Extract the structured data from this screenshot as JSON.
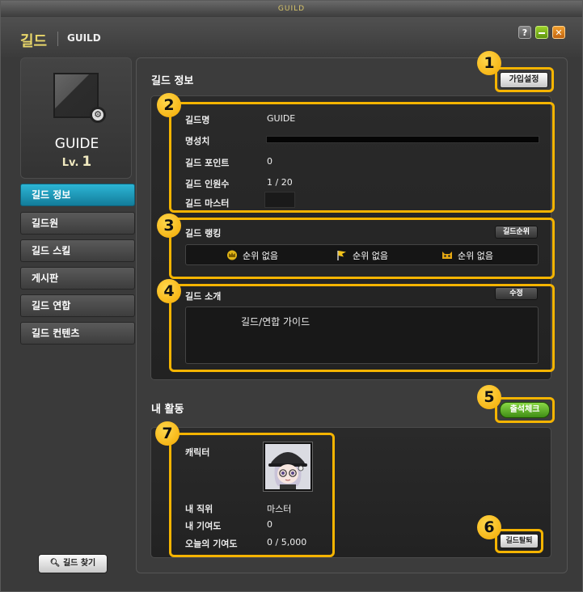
{
  "window": {
    "title": "GUILD"
  },
  "header": {
    "title": "길드",
    "subtitle": "GUILD",
    "help": "?",
    "minimize": "—",
    "close": "✕"
  },
  "sidebar": {
    "guild_name": "GUIDE",
    "level_label": "Lv.",
    "level": "1",
    "nav": [
      {
        "label": "길드 정보",
        "active": true
      },
      {
        "label": "길드원"
      },
      {
        "label": "길드 스킬"
      },
      {
        "label": "게시판"
      },
      {
        "label": "길드 연합"
      },
      {
        "label": "길드 컨텐츠"
      }
    ],
    "find_button": "길드 찾기"
  },
  "info": {
    "title": "길드 정보",
    "join_settings_button": "가입설정",
    "rows": [
      {
        "label": "길드명",
        "value": "GUIDE"
      },
      {
        "label": "명성치",
        "value": ""
      },
      {
        "label": "길드 포인트",
        "value": "0"
      },
      {
        "label": "길드 인원수",
        "value": "1 / 20"
      },
      {
        "label": "길드 마스터",
        "value": ""
      }
    ]
  },
  "ranking": {
    "title": "길드 랭킹",
    "button": "길드순위",
    "items": [
      {
        "icon": "crown-icon",
        "text": "순위 없음"
      },
      {
        "icon": "flag-icon",
        "text": "순위 없음"
      },
      {
        "icon": "mask-icon",
        "text": "순위 없음"
      }
    ]
  },
  "intro": {
    "title": "길드 소개",
    "edit_button": "수정",
    "text": "길드/연합 가이드"
  },
  "activity": {
    "title": "내 활동",
    "attendance_button": "출석체크",
    "character_label": "캐릭터",
    "rows": [
      {
        "label": "내 직위",
        "value": "마스터"
      },
      {
        "label": "내 기여도",
        "value": "0"
      },
      {
        "label": "오늘의 기여도",
        "value": "0 / 5,000"
      }
    ],
    "leave_button": "길드탈퇴"
  },
  "badges": [
    "1",
    "2",
    "3",
    "4",
    "5",
    "6",
    "7"
  ],
  "colors": {
    "highlight": "#f5b400",
    "active_nav": "#1fa3c4",
    "title": "#e8d66a"
  }
}
